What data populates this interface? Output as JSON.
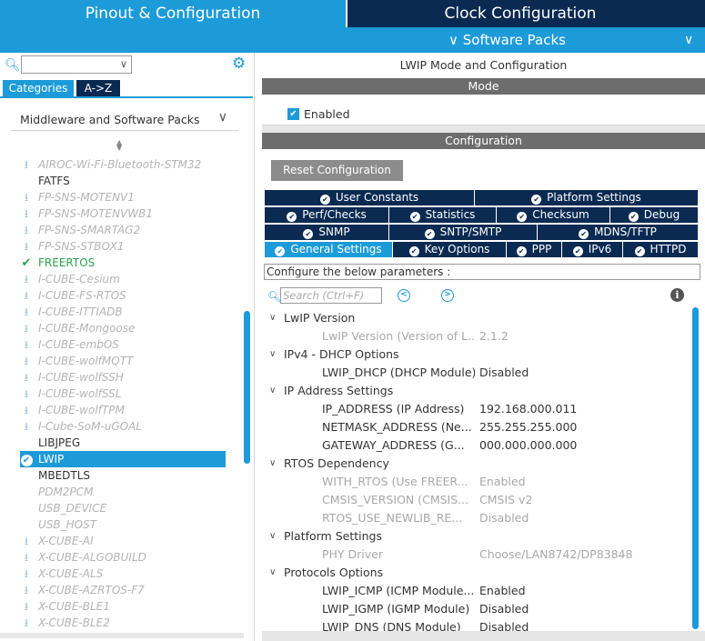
{
  "header": {
    "tab_pinout": "Pinout & Configuration",
    "tab_clock": "Clock Configuration",
    "software_packs": "Software Packs",
    "software_packs_chevron": "chevron-down-icon"
  },
  "left": {
    "search_value": "",
    "tab_categories": "Categories",
    "tab_az": "A->Z",
    "category_header": "Middleware and Software Packs",
    "packs": [
      {
        "label": "AIROC-Wi-Fi-Bluetooth-STM32",
        "state": "disabled",
        "icon": "download-icon"
      },
      {
        "label": "FATFS",
        "state": "normal",
        "icon": ""
      },
      {
        "label": "FP-SNS-MOTENV1",
        "state": "disabled",
        "icon": "download-icon"
      },
      {
        "label": "FP-SNS-MOTENVWB1",
        "state": "disabled",
        "icon": "download-icon"
      },
      {
        "label": "FP-SNS-SMARTAG2",
        "state": "disabled",
        "icon": "download-icon"
      },
      {
        "label": "FP-SNS-STBOX1",
        "state": "disabled",
        "icon": "download-icon"
      },
      {
        "label": "FREERTOS",
        "state": "enabled",
        "icon": "check-icon"
      },
      {
        "label": "I-CUBE-Cesium",
        "state": "disabled",
        "icon": "download-icon"
      },
      {
        "label": "I-CUBE-FS-RTOS",
        "state": "disabled",
        "icon": "download-icon"
      },
      {
        "label": "I-CUBE-ITTIADB",
        "state": "disabled",
        "icon": "download-icon"
      },
      {
        "label": "I-CUBE-Mongoose",
        "state": "disabled",
        "icon": "download-icon"
      },
      {
        "label": "I-CUBE-embOS",
        "state": "disabled",
        "icon": "download-icon"
      },
      {
        "label": "I-CUBE-wolfMQTT",
        "state": "disabled",
        "icon": "download-icon"
      },
      {
        "label": "I-CUBE-wolfSSH",
        "state": "disabled",
        "icon": "download-icon"
      },
      {
        "label": "I-CUBE-wolfSSL",
        "state": "disabled",
        "icon": "download-icon"
      },
      {
        "label": "I-CUBE-wolfTPM",
        "state": "disabled",
        "icon": "download-icon"
      },
      {
        "label": "I-Cube-SoM-uGOAL",
        "state": "disabled",
        "icon": "download-icon"
      },
      {
        "label": "LIBJPEG",
        "state": "normal",
        "icon": ""
      },
      {
        "label": "LWIP",
        "state": "selected",
        "icon": "check-circle-icon"
      },
      {
        "label": "MBEDTLS",
        "state": "normal",
        "icon": ""
      },
      {
        "label": "PDM2PCM",
        "state": "disabled",
        "icon": ""
      },
      {
        "label": "USB_DEVICE",
        "state": "disabled",
        "icon": ""
      },
      {
        "label": "USB_HOST",
        "state": "disabled",
        "icon": ""
      },
      {
        "label": "X-CUBE-AI",
        "state": "disabled",
        "icon": "download-icon"
      },
      {
        "label": "X-CUBE-ALGOBUILD",
        "state": "disabled",
        "icon": "download-icon"
      },
      {
        "label": "X-CUBE-ALS",
        "state": "disabled",
        "icon": "download-icon"
      },
      {
        "label": "X-CUBE-AZRTOS-F7",
        "state": "disabled",
        "icon": "download-icon"
      },
      {
        "label": "X-CUBE-BLE1",
        "state": "disabled",
        "icon": "download-icon"
      },
      {
        "label": "X-CUBE-BLE2",
        "state": "disabled",
        "icon": "download-icon"
      }
    ]
  },
  "right": {
    "title": "LWIP Mode and Configuration",
    "mode_header": "Mode",
    "enabled_label": "Enabled",
    "enabled_checked": true,
    "config_header": "Configuration",
    "reset_button": "Reset Configuration",
    "tabs_row1": [
      "User Constants",
      "Platform Settings"
    ],
    "tabs_row2": [
      "Perf/Checks",
      "Statistics",
      "Checksum",
      "Debug"
    ],
    "tabs_row3": [
      "SNMP",
      "SNTP/SMTP",
      "MDNS/TFTP"
    ],
    "tabs_row4": [
      "General Settings",
      "Key Options",
      "PPP",
      "IPv6",
      "HTTPD"
    ],
    "active_tab": "General Settings",
    "description": "Configure the below parameters :",
    "search_placeholder": "Search (Ctrl+F)",
    "groups": [
      {
        "title": "LwIP Version",
        "params": [
          {
            "key": "LwIP Version (Version of L...",
            "value": "2.1.2",
            "dim": true
          }
        ]
      },
      {
        "title": "IPv4 - DHCP Options",
        "params": [
          {
            "key": "LWIP_DHCP (DHCP Module)",
            "value": "Disabled",
            "dim": false
          }
        ]
      },
      {
        "title": "IP Address Settings",
        "params": [
          {
            "key": "IP_ADDRESS (IP Address)",
            "value": "192.168.000.011",
            "dim": false
          },
          {
            "key": "NETMASK_ADDRESS (Ne...",
            "value": "255.255.255.000",
            "dim": false
          },
          {
            "key": "GATEWAY_ADDRESS (G...",
            "value": "000.000.000.000",
            "dim": false
          }
        ]
      },
      {
        "title": "RTOS Dependency",
        "params": [
          {
            "key": "WITH_RTOS (Use FREER...",
            "value": "Enabled",
            "dim": true
          },
          {
            "key": "CMSIS_VERSION (CMSIS...",
            "value": "CMSIS v2",
            "dim": true
          },
          {
            "key": "RTOS_USE_NEWLIB_RE...",
            "value": "Disabled",
            "dim": true
          }
        ]
      },
      {
        "title": "Platform Settings",
        "params": [
          {
            "key": "PHY Driver",
            "value": "Choose/LAN8742/DP83848",
            "dim": true
          }
        ]
      },
      {
        "title": "Protocols Options",
        "params": [
          {
            "key": "LWIP_ICMP (ICMP Module...",
            "value": "Enabled",
            "dim": false
          },
          {
            "key": "LWIP_IGMP (IGMP Module)",
            "value": "Disabled",
            "dim": false
          },
          {
            "key": "LWIP_DNS (DNS Module)",
            "value": "Disabled",
            "dim": false
          }
        ]
      }
    ]
  },
  "colors": {
    "accent": "#1d9bd8",
    "navy": "#0a2a52",
    "enabled_green": "#2f9e4a",
    "section_gray": "#6d6d6d"
  }
}
